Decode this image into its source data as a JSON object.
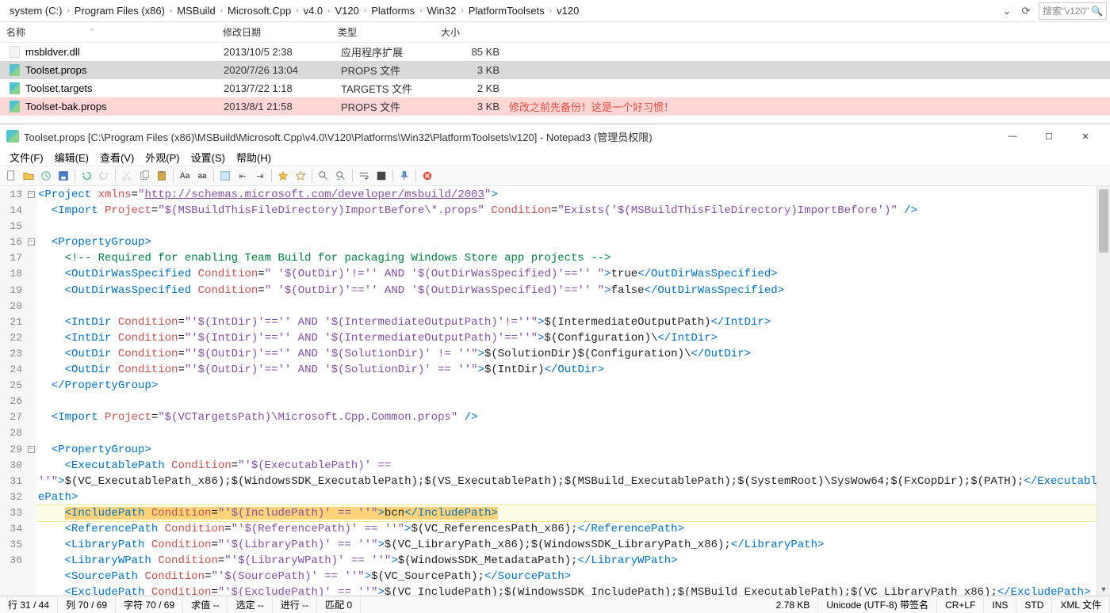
{
  "breadcrumb": [
    "system (C:)",
    "Program Files (x86)",
    "MSBuild",
    "Microsoft.Cpp",
    "v4.0",
    "V120",
    "Platforms",
    "Win32",
    "PlatformToolsets",
    "v120"
  ],
  "search_placeholder": "搜索\"v120\"",
  "cols": {
    "name": "名称",
    "date": "修改日期",
    "type": "类型",
    "size": "大小"
  },
  "files": [
    {
      "icon": "dll",
      "name": "msbldver.dll",
      "date": "2013/10/5 2:38",
      "type": "应用程序扩展",
      "size": "85 KB",
      "sel": false,
      "hl": false
    },
    {
      "icon": "props",
      "name": "Toolset.props",
      "date": "2020/7/26 13:04",
      "type": "PROPS 文件",
      "size": "3 KB",
      "sel": true,
      "hl": false
    },
    {
      "icon": "props",
      "name": "Toolset.targets",
      "date": "2013/7/22 1:18",
      "type": "TARGETS 文件",
      "size": "2 KB",
      "sel": false,
      "hl": false
    },
    {
      "icon": "props",
      "name": "Toolset-bak.props",
      "date": "2013/8/1 21:58",
      "type": "PROPS 文件",
      "size": "3 KB",
      "sel": false,
      "hl": true
    }
  ],
  "annotation": "修改之前先备份！这是一个好习惯！",
  "np3": {
    "title": "Toolset.props [C:\\Program Files (x86)\\MSBuild\\Microsoft.Cpp\\v4.0\\V120\\Platforms\\Win32\\PlatformToolsets\\v120] - Notepad3   (管理员权限)",
    "menu": [
      "文件(F)",
      "编辑(E)",
      "查看(V)",
      "外观(P)",
      "设置(S)",
      "帮助(H)"
    ]
  },
  "line_start": 13,
  "line_end": 36,
  "status": {
    "line": "行  31 / 44",
    "col": "列  70 / 69",
    "char": "字符  70 / 69",
    "val": "求值  --",
    "sel": "选定  --",
    "prog": "进行  --",
    "match": "匹配  0",
    "size": "2.78 KB",
    "enc": "Unicode (UTF-8) 带签名",
    "eol": "CR+LF",
    "ins": "INS",
    "std": "STD",
    "ft": "XML 文件"
  }
}
